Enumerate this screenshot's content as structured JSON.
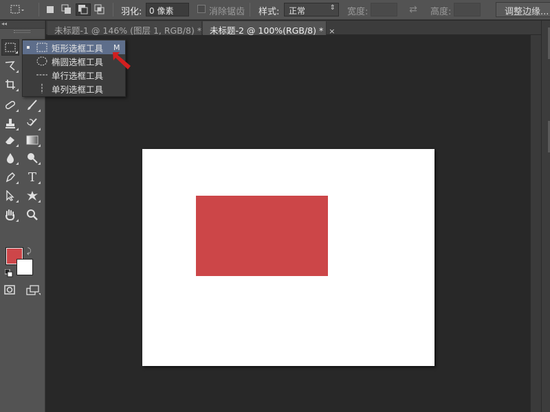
{
  "options_bar": {
    "feather_label": "羽化:",
    "feather_value": "0 像素",
    "antialias_label": "消除锯齿",
    "style_label": "样式:",
    "style_value": "正常",
    "width_label": "宽度:",
    "height_label": "高度:",
    "refine_button": "调整边缘..."
  },
  "toolbox": {
    "collapse_glyph": "◂◂"
  },
  "tabs": [
    {
      "label": "未标题-1 @ 146% (图层 1, RGB/8) *",
      "close": "×",
      "active": false
    },
    {
      "label": "未标题-2 @ 100%(RGB/8) *",
      "close": "×",
      "active": true
    }
  ],
  "flyout": {
    "items": [
      {
        "label": "矩形选框工具",
        "shortcut": "M",
        "icon": "rect-marquee-icon",
        "selected": true
      },
      {
        "label": "椭圆选框工具",
        "shortcut": "",
        "icon": "ellipse-marquee-icon",
        "selected": false
      },
      {
        "label": "单行选框工具",
        "shortcut": "",
        "icon": "single-row-marquee-icon",
        "selected": false
      },
      {
        "label": "单列选框工具",
        "shortcut": "",
        "icon": "single-column-marquee-icon",
        "selected": false
      }
    ]
  },
  "colors": {
    "foreground": "#cd4649",
    "background": "#ffffff",
    "shape_fill": "#cc4648",
    "flyout_highlight": "#5e6e8b",
    "annotation_arrow": "#d21f1f"
  }
}
